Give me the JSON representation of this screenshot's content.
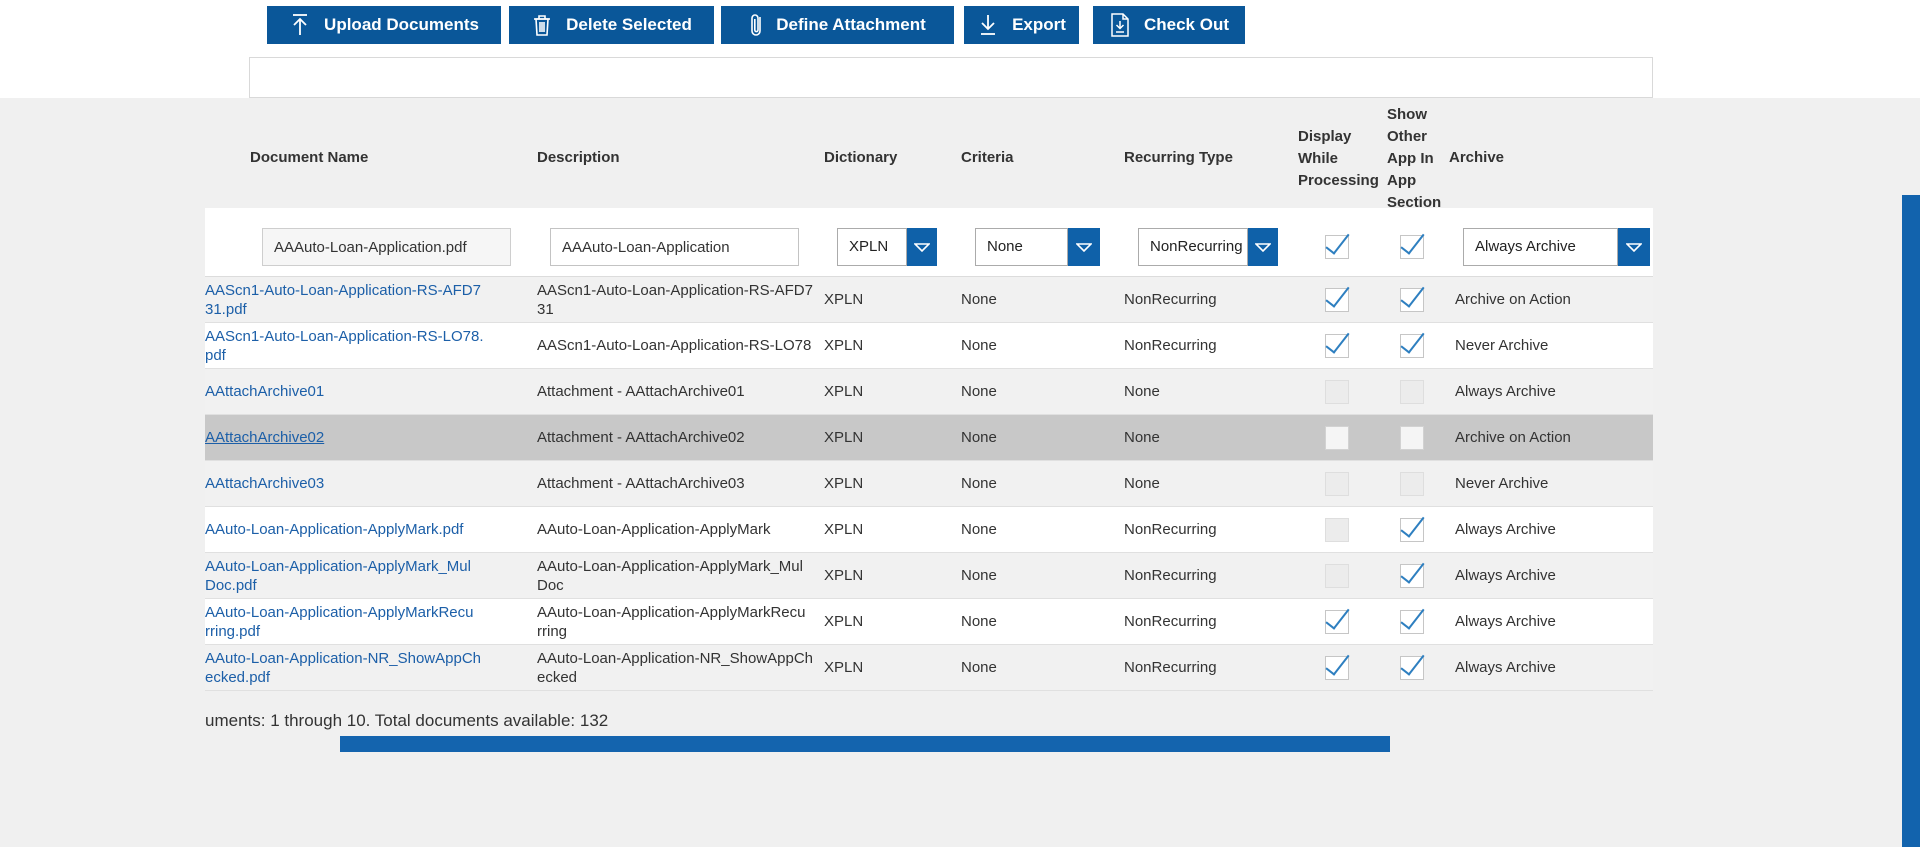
{
  "toolbar": {
    "buttons": [
      {
        "label": "Upload Documents",
        "icon": "upload-icon"
      },
      {
        "label": "Delete Selected",
        "icon": "trash-icon"
      },
      {
        "label": "Define Attachment",
        "icon": "paperclip-icon"
      },
      {
        "label": "Export",
        "icon": "download-icon"
      },
      {
        "label": "Check Out",
        "icon": "checkout-icon"
      }
    ]
  },
  "table": {
    "headers": [
      "Document Name",
      "Description",
      "Dictionary",
      "Criteria",
      "Recurring Type",
      "Display\nWhile\nProcessing",
      "Show\nOther\nApp In\nApp\nSection",
      "Archive"
    ],
    "filter_row": {
      "document_name": "AAAuto-Loan-Application.pdf",
      "description": "AAAuto-Loan-Application",
      "dictionary": "XPLN",
      "criteria": "None",
      "recurring_type": "NonRecurring",
      "display_while_processing": true,
      "show_other_app_in_app_section": true,
      "archive": "Always Archive"
    },
    "rows": [
      {
        "name": "AAScn1-Auto-Loan-Application-RS-AFD7\n31.pdf",
        "description": "AAScn1-Auto-Loan-Application-RS-AFD7\n31",
        "dictionary": "XPLN",
        "criteria": "None",
        "recurring_type": "NonRecurring",
        "display_while_processing": true,
        "show_other_app": true,
        "archive": "Archive on Action",
        "selected": false
      },
      {
        "name": "AAScn1-Auto-Loan-Application-RS-LO78.\npdf",
        "description": "AAScn1-Auto-Loan-Application-RS-LO78",
        "dictionary": "XPLN",
        "criteria": "None",
        "recurring_type": "NonRecurring",
        "display_while_processing": true,
        "show_other_app": true,
        "archive": "Never Archive",
        "selected": false
      },
      {
        "name": "AAttachArchive01",
        "description": "Attachment - AAttachArchive01",
        "dictionary": "XPLN",
        "criteria": "None",
        "recurring_type": "None",
        "display_while_processing": false,
        "show_other_app": false,
        "archive": "Always Archive",
        "selected": false
      },
      {
        "name": "AAttachArchive02",
        "description": "Attachment - AAttachArchive02",
        "dictionary": "XPLN",
        "criteria": "None",
        "recurring_type": "None",
        "display_while_processing": false,
        "show_other_app": false,
        "archive": "Archive on Action",
        "selected": true
      },
      {
        "name": "AAttachArchive03",
        "description": "Attachment - AAttachArchive03",
        "dictionary": "XPLN",
        "criteria": "None",
        "recurring_type": "None",
        "display_while_processing": false,
        "show_other_app": false,
        "archive": "Never Archive",
        "selected": false
      },
      {
        "name": "AAuto-Loan-Application-ApplyMark.pdf",
        "description": "AAuto-Loan-Application-ApplyMark",
        "dictionary": "XPLN",
        "criteria": "None",
        "recurring_type": "NonRecurring",
        "display_while_processing": false,
        "show_other_app": true,
        "archive": "Always Archive",
        "selected": false
      },
      {
        "name": "AAuto-Loan-Application-ApplyMark_Mul\nDoc.pdf",
        "description": "AAuto-Loan-Application-ApplyMark_Mul\nDoc",
        "dictionary": "XPLN",
        "criteria": "None",
        "recurring_type": "NonRecurring",
        "display_while_processing": false,
        "show_other_app": true,
        "archive": "Always Archive",
        "selected": false
      },
      {
        "name": "AAuto-Loan-Application-ApplyMarkRecu\nrring.pdf",
        "description": "AAuto-Loan-Application-ApplyMarkRecu\nrring",
        "dictionary": "XPLN",
        "criteria": "None",
        "recurring_type": "NonRecurring",
        "display_while_processing": true,
        "show_other_app": true,
        "archive": "Always Archive",
        "selected": false
      },
      {
        "name": "AAuto-Loan-Application-NR_ShowAppCh\necked.pdf",
        "description": "AAuto-Loan-Application-NR_ShowAppCh\necked",
        "dictionary": "XPLN",
        "criteria": "None",
        "recurring_type": "NonRecurring",
        "display_while_processing": true,
        "show_other_app": true,
        "archive": "Always Archive",
        "selected": false
      }
    ],
    "footer": "uments: 1 through 10. Total documents available: 132"
  },
  "colors": {
    "toolbar_blue": "#0a5799",
    "control_blue": "#0f61a9",
    "link_blue": "#1c5fa8",
    "check_blue": "#2e7fc0",
    "selected_row": "#c8c8c8",
    "zebra_gray": "#f1f1f1",
    "panel_gray": "#f0f0f0",
    "scrollbar_blue": "#1464ae"
  }
}
